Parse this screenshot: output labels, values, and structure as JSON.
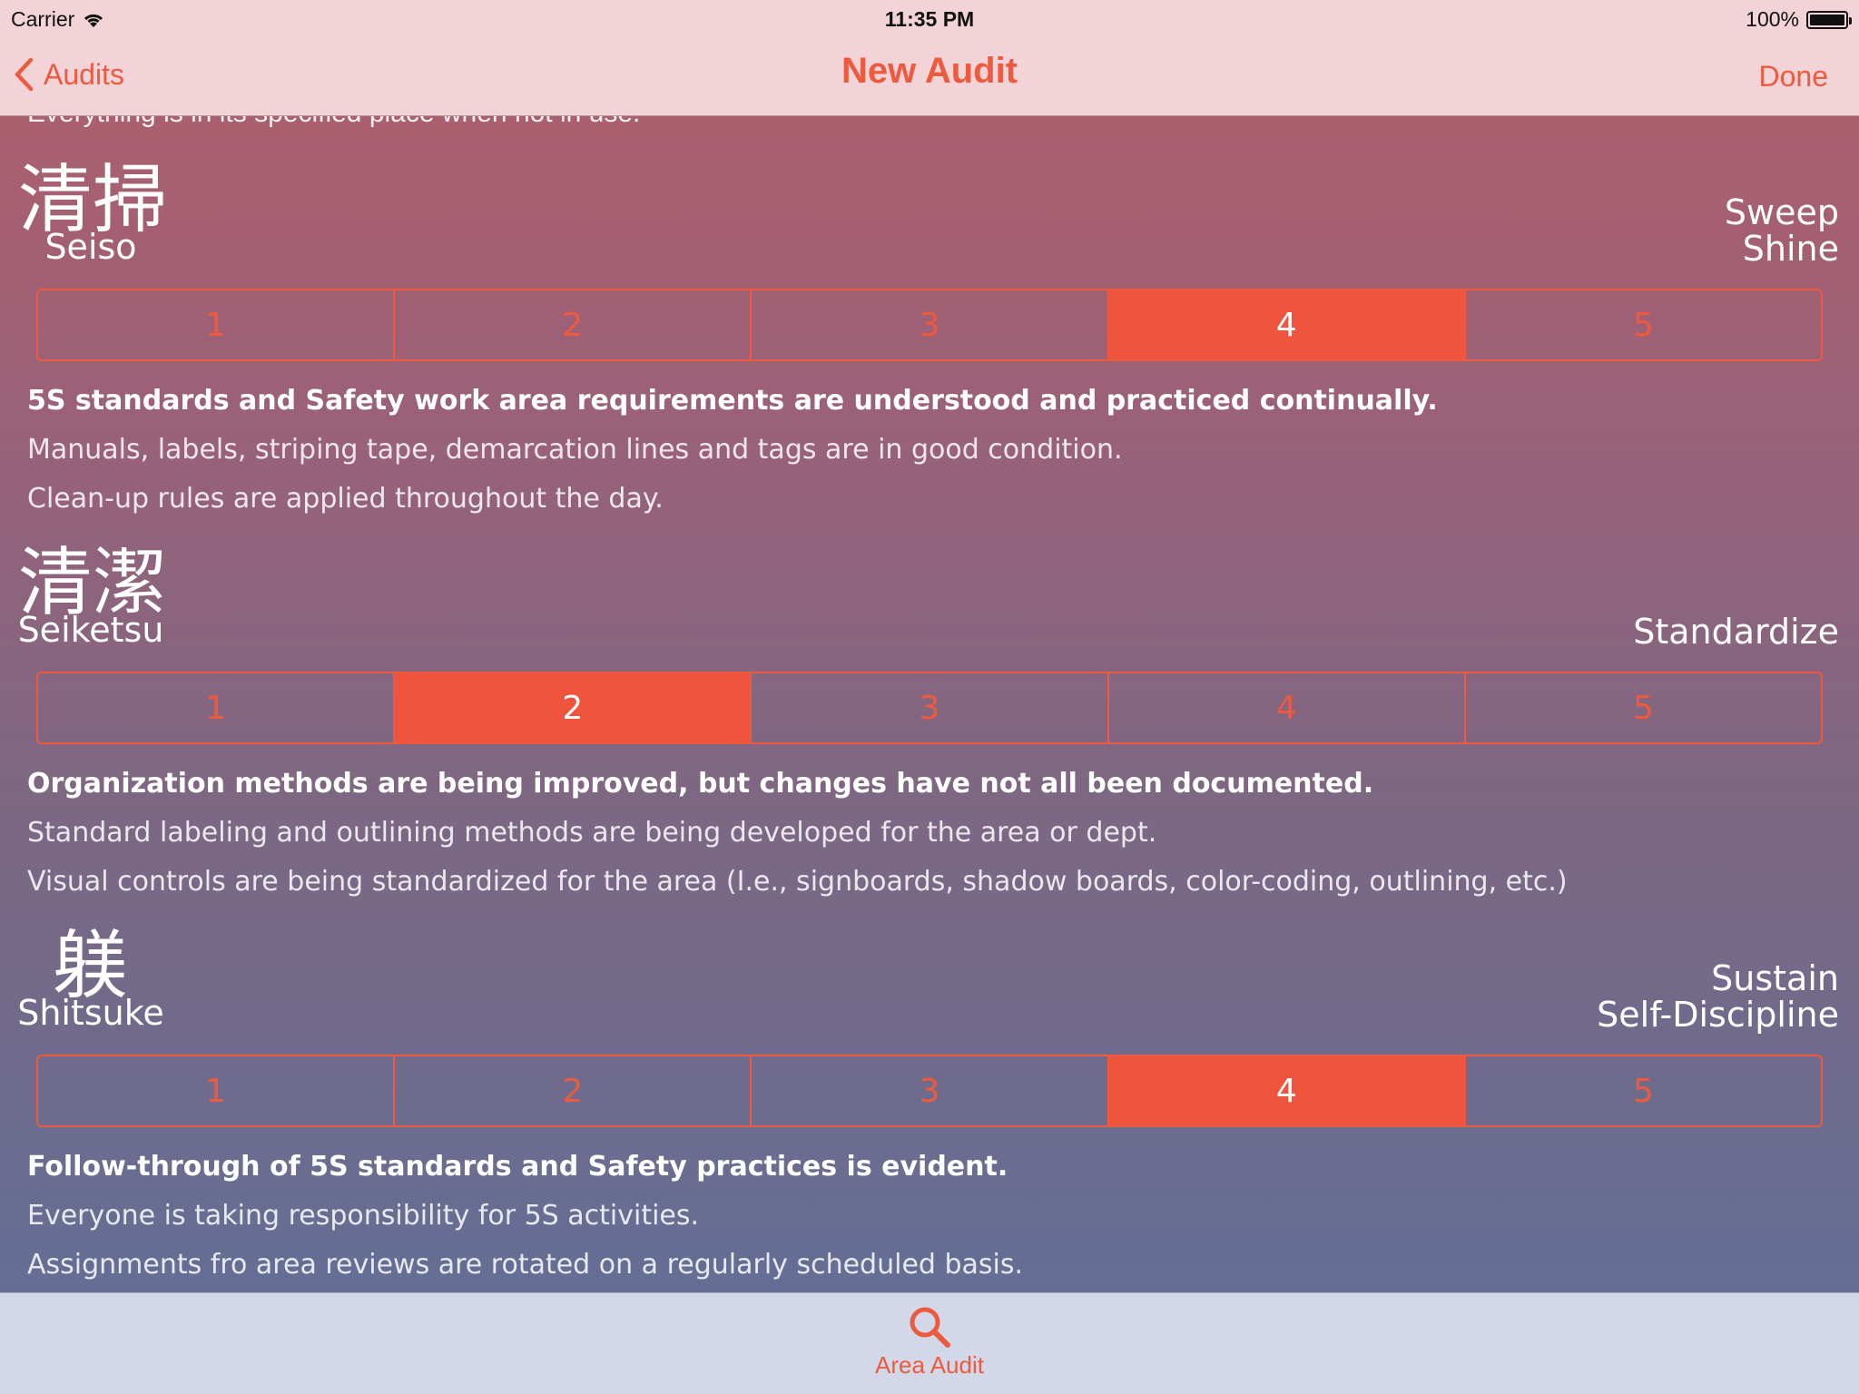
{
  "status": {
    "carrier": "Carrier",
    "time": "11:35 PM",
    "battery": "100%"
  },
  "nav": {
    "back_label": "Audits",
    "title": "New Audit",
    "done_label": "Done"
  },
  "ghost_text": "Everything is in its specified place when not in use.",
  "sections": [
    {
      "kanji": "清掃",
      "romaji": "Seiso",
      "meaning_line1": "Sweep",
      "meaning_line2": "Shine",
      "selected": 4,
      "segments": [
        "1",
        "2",
        "3",
        "4",
        "5"
      ],
      "headline": "5S standards and Safety work area requirements are understood and practiced continually.",
      "line1": "Manuals, labels, striping tape, demarcation lines and tags are in good condition.",
      "line2": "Clean-up rules are applied throughout the day."
    },
    {
      "kanji": "清潔",
      "romaji": "Seiketsu",
      "meaning_line1": "",
      "meaning_line2": "Standardize",
      "selected": 2,
      "segments": [
        "1",
        "2",
        "3",
        "4",
        "5"
      ],
      "headline": "Organization methods are being improved, but changes have not all been documented.",
      "line1": "Standard labeling and outlining methods are being developed for the area or dept.",
      "line2": "Visual controls are being standardized for the area (I.e., signboards, shadow boards, color-coding, outlining, etc.)"
    },
    {
      "kanji": "躾",
      "romaji": "Shitsuke",
      "meaning_line1": "Sustain",
      "meaning_line2": "Self-Discipline",
      "selected": 4,
      "segments": [
        "1",
        "2",
        "3",
        "4",
        "5"
      ],
      "headline": "Follow-through of 5S standards and Safety practices is evident.",
      "line1": "Everyone is taking responsibility for 5S activities.",
      "line2": "Assignments fro area reviews are rotated on a regularly scheduled basis."
    }
  ],
  "tabbar": {
    "tab_label": "Area Audit",
    "tab_icon": "search-icon"
  },
  "colors": {
    "accent": "#ee5a3e"
  }
}
